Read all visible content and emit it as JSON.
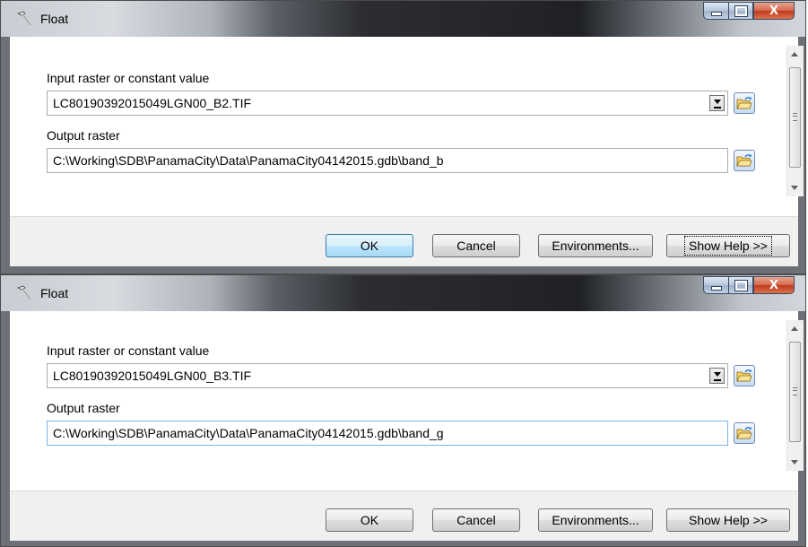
{
  "windows": [
    {
      "title": "Float",
      "input_label": "Input raster or constant value",
      "input_value": "LC80190392015049LGN00_B2.TIF",
      "output_label": "Output raster",
      "output_value": "C:\\Working\\SDB\\PanamaCity\\Data\\PanamaCity04142015.gdb\\band_b",
      "buttons": {
        "ok": "OK",
        "cancel": "Cancel",
        "environments": "Environments...",
        "show_help": "Show Help >>"
      },
      "window_controls": {
        "close": "X"
      }
    },
    {
      "title": "Float",
      "input_label": "Input raster or constant value",
      "input_value": "LC80190392015049LGN00_B3.TIF",
      "output_label": "Output raster",
      "output_value": "C:\\Working\\SDB\\PanamaCity\\Data\\PanamaCity04142015.gdb\\band_g",
      "buttons": {
        "ok": "OK",
        "cancel": "Cancel",
        "environments": "Environments...",
        "show_help": "Show Help >>"
      },
      "window_controls": {
        "close": "X"
      }
    }
  ],
  "icons": {
    "tool": "hammer-icon",
    "browse": "open-folder-icon",
    "combo": "chevron-down-icon"
  },
  "colors": {
    "default_button": "#bee6fd",
    "close_button": "#c0391c",
    "titlebar_dark": "#25272b"
  }
}
